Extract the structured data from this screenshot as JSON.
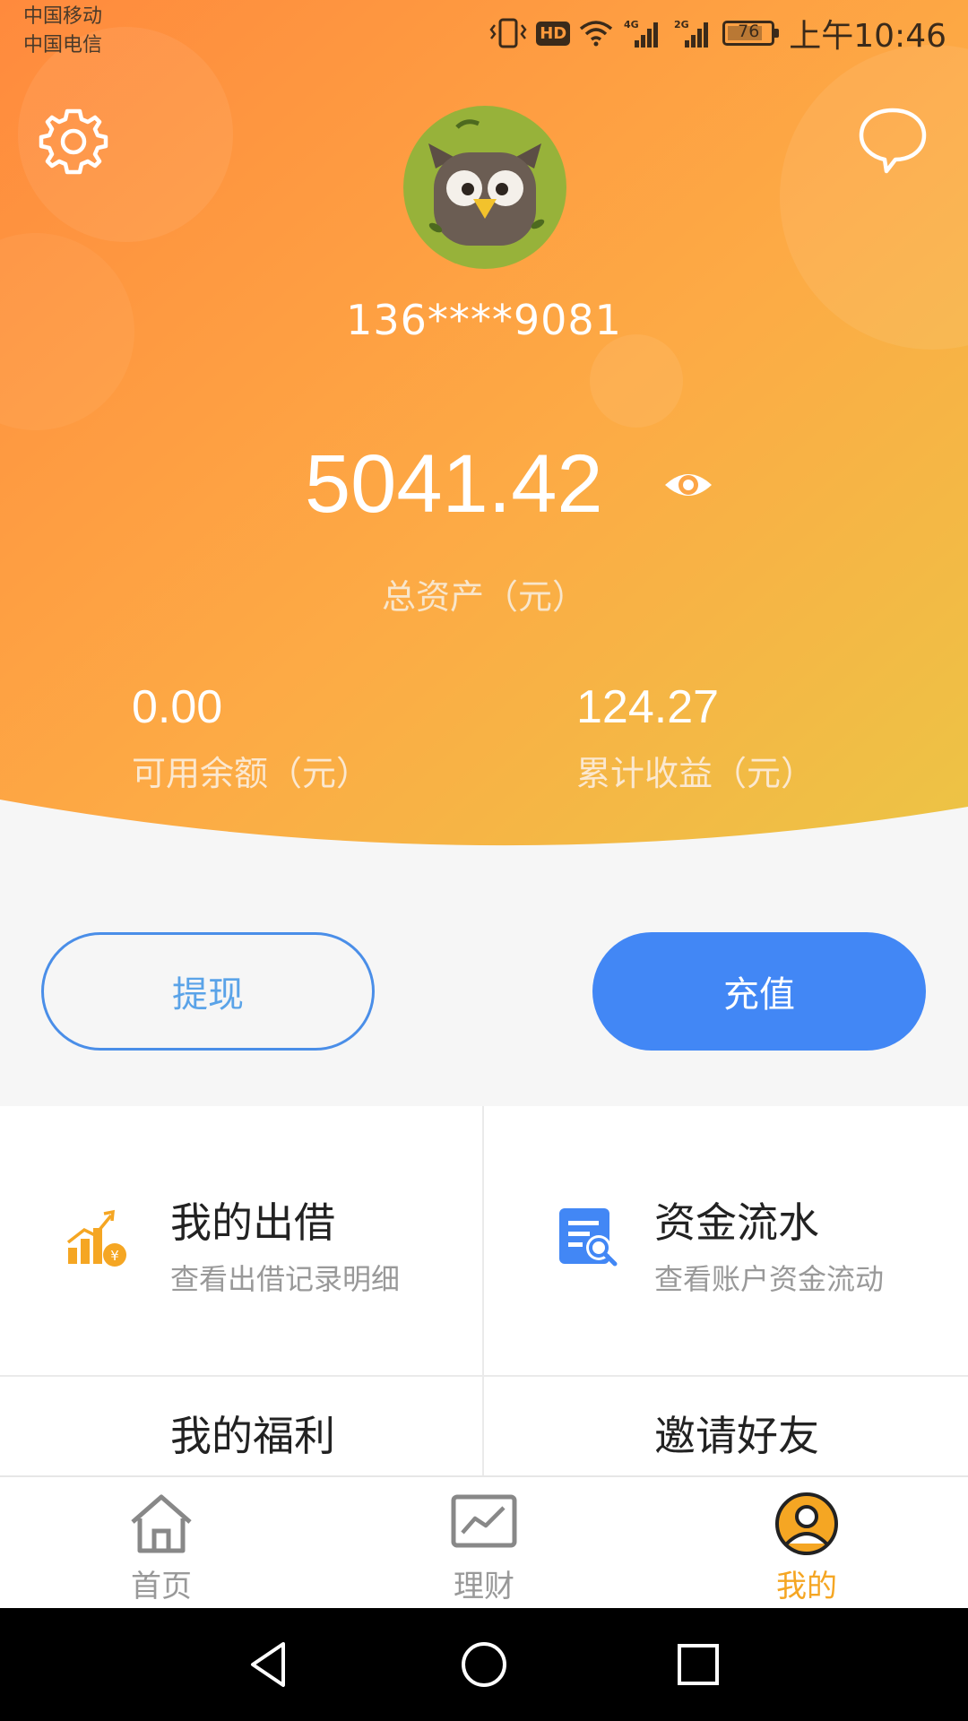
{
  "status_bar": {
    "carrier_1": "中国移动",
    "carrier_2": "中国电信",
    "hd": "HD",
    "net_4g": "4G",
    "net_2g": "2G",
    "battery": "76",
    "time": "上午10:46"
  },
  "header": {
    "settings_icon": "gear-icon",
    "message_icon": "chat-bubble-icon",
    "avatar_icon": "owl-avatar",
    "phone": "136****9081",
    "total_amount": "5041.42",
    "eye_icon": "eye-icon",
    "total_label": "总资产（元）",
    "available_value": "0.00",
    "available_label": "可用余额（元）",
    "earnings_value": "124.27",
    "earnings_label": "累计收益（元）"
  },
  "actions": {
    "withdraw": "提现",
    "recharge": "充值"
  },
  "grid": [
    {
      "title": "我的出借",
      "desc": "查看出借记录明细",
      "icon": "bar-chart-yen-icon"
    },
    {
      "title": "资金流水",
      "desc": "查看账户资金流动",
      "icon": "document-search-icon"
    },
    {
      "title": "我的福利",
      "desc": "",
      "icon": ""
    },
    {
      "title": "邀请好友",
      "desc": "",
      "icon": ""
    }
  ],
  "tabs": [
    {
      "label": "首页",
      "icon": "home-icon"
    },
    {
      "label": "理财",
      "icon": "chart-icon"
    },
    {
      "label": "我的",
      "icon": "user-icon",
      "active": true
    }
  ],
  "colors": {
    "gradient_start": "#ff8a3d",
    "gradient_end": "#ecc445",
    "accent_blue": "#4287f5",
    "active_tab": "#f5a623"
  }
}
